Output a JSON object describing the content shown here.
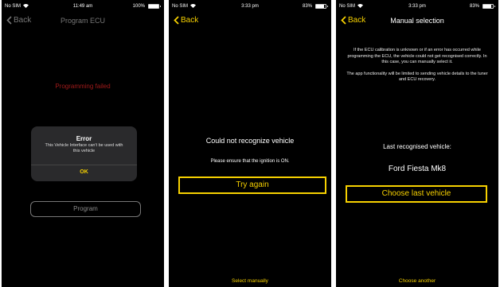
{
  "screen1": {
    "status": {
      "carrier": "No SIM",
      "time": "11:49 am",
      "battery": "100%",
      "battery_level": 1.0
    },
    "back_label": "Back",
    "title": "Program ECU",
    "failed_text": "Programming failed",
    "alert": {
      "title": "Error",
      "message": "This Vehicle Interface can't be used with this vehicle",
      "ok_label": "OK"
    },
    "program_label": "Program"
  },
  "screen2": {
    "status": {
      "carrier": "No SIM",
      "time": "3:33 pm",
      "battery": "83%",
      "battery_level": 0.83
    },
    "back_label": "Back",
    "headline": "Could not recognize vehicle",
    "hint": "Please ensure that the ignition is ON.",
    "try_again_label": "Try again",
    "select_manually_label": "Select manually"
  },
  "screen3": {
    "status": {
      "carrier": "No SIM",
      "time": "3:33 pm",
      "battery": "83%",
      "battery_level": 0.83
    },
    "back_label": "Back",
    "title": "Manual selection",
    "info_p1": "If the ECU calibration is unknown or if an error has occurred while programming the ECU, the vehicle could not get recognised correctly. In this case, you can manually select it.",
    "info_p2": "The app functionality will be limited to sending vehicle details to the tuner and ECU recovery.",
    "last_label": "Last recognised vehicle:",
    "vehicle": "Ford Fiesta Mk8",
    "choose_last_label": "Choose last vehicle",
    "choose_another_label": "Choose another"
  },
  "colors": {
    "accent": "#f7d100",
    "error": "#a11a1a",
    "background": "#000000"
  }
}
